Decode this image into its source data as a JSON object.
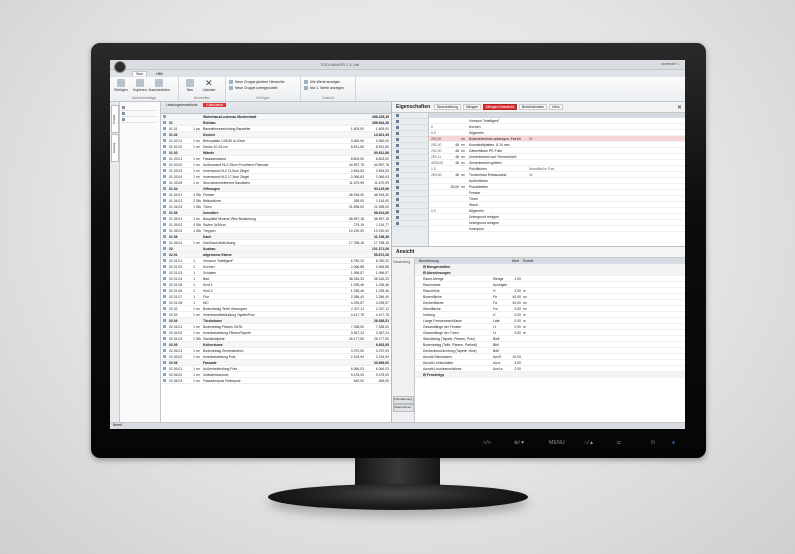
{
  "window": {
    "title": "TOOLMAKER 2.4 Lite",
    "user": "Anwender 1"
  },
  "ribbon": {
    "tabs": [
      "Start",
      "Hilfe"
    ],
    "groups": [
      {
        "label": "Zwischenablage",
        "buttons": [
          "Einfügen",
          "Kopieren",
          "Ausschneiden"
        ]
      },
      {
        "label": "Bearbeiten",
        "buttons": [
          "Neu",
          "Löschen"
        ]
      },
      {
        "label": "Einfügen",
        "small": [
          "Neue Gruppe gleicher Hierarchie",
          "Neue Gruppe untergeordnet"
        ]
      },
      {
        "label": "Ansicht",
        "small": [
          "Alle Werte anzeigen",
          "Nur 1. Werte anzeigen"
        ]
      }
    ]
  },
  "left_tabs": [
    "Projekt",
    "Katalog"
  ],
  "center": {
    "tabs": [
      "Leistungsverzeichnis",
      "Kalkulation"
    ],
    "rows": [
      {
        "pos": "",
        "qty": "",
        "u": "",
        "desc": "Wohnhaus/Lustenau Musterstadt",
        "p": "",
        "t": "286.225,35",
        "bold": true
      },
      {
        "pos": "01",
        "qty": "",
        "u": "",
        "desc": "Rohbau",
        "p": "",
        "t": "258.544,28",
        "bold": true
      },
      {
        "pos": "01.01",
        "qty": "1",
        "u": "pa",
        "desc": "Baustelleneinrichtung Baustelle",
        "p": "1.605,00",
        "t": "1.605,00",
        "bold": false
      },
      {
        "pos": "01.02",
        "qty": "",
        "u": "",
        "desc": "Decken",
        "p": "",
        "t": "14.301,49",
        "bold": true
      },
      {
        "pos": "01.02.01",
        "qty": "1",
        "u": "m²",
        "desc": "Betonplatte C25/30 d=20cm",
        "p": "3.360,00",
        "t": "3.360,00",
        "bold": false
      },
      {
        "pos": "01.02.02",
        "qty": "1",
        "u": "m²",
        "desc": "Decke 20-25 cm",
        "p": "8.531,60",
        "t": "8.531,60",
        "bold": false
      },
      {
        "pos": "01.03",
        "qty": "",
        "u": "",
        "desc": "Wände",
        "p": "",
        "t": "69.811,86",
        "bold": true
      },
      {
        "pos": "01.03.01",
        "qty": "1",
        "u": "m²",
        "desc": "Fassadenwand",
        "p": "8.803,00",
        "t": "8.803,00",
        "bold": false
      },
      {
        "pos": "01.03.02",
        "qty": "1",
        "u": "m²",
        "desc": "Außenwand HLZ 25cm Porotherm Plansatz",
        "p": "44.957,78",
        "t": "44.957,78",
        "bold": false
      },
      {
        "pos": "01.03.03",
        "qty": "1",
        "u": "m²",
        "desc": "Innenwand HLZ 11,5cm Ziegel",
        "p": "2.694,63",
        "t": "2.694,63",
        "bold": false
      },
      {
        "pos": "01.03.04",
        "qty": "1",
        "u": "m²",
        "desc": "Innenwand HLZ 17,5cm Ziegel",
        "p": "2.066,63",
        "t": "2.066,63",
        "bold": false
      },
      {
        "pos": "01.03.05",
        "qty": "1",
        "u": "m",
        "desc": "Sturzdeckenelement Sandstein",
        "p": "11.679,99",
        "t": "11.679,99",
        "bold": false
      },
      {
        "pos": "01.04",
        "qty": "",
        "u": "",
        "desc": "Öffnungen",
        "p": "",
        "t": "93.119,06",
        "bold": true
      },
      {
        "pos": "01.04.01",
        "qty": "3",
        "u": "Stk",
        "desc": "Fenster",
        "p": "46.918,40",
        "t": "46.918,40",
        "bold": false
      },
      {
        "pos": "01.04.02",
        "qty": "2",
        "u": "Stk",
        "desc": "Balkontüren",
        "p": "285,00",
        "t": "1.118,00",
        "bold": false
      },
      {
        "pos": "01.04.03",
        "qty": "1",
        "u": "Stk",
        "desc": "Türen",
        "p": "21.598,00",
        "t": "21.598,00",
        "bold": false
      },
      {
        "pos": "01.05",
        "qty": "",
        "u": "",
        "desc": "Innentüre",
        "p": "",
        "t": "58.614,80",
        "bold": true
      },
      {
        "pos": "01.05.01",
        "qty": "1",
        "u": "m²",
        "desc": "Bauplatte Mineral Vlies Bedachung",
        "p": "58.957,18",
        "t": "58.957,18",
        "bold": false
      },
      {
        "pos": "01.05.02",
        "qty": "4",
        "u": "Stk",
        "desc": "Stufen 3x30cm",
        "p": "279,19",
        "t": "1.116,77",
        "bold": false
      },
      {
        "pos": "01.05.03",
        "qty": "1",
        "u": "Stk",
        "desc": "Treppen",
        "p": "10.190,00",
        "t": "10.190,00",
        "bold": false
      },
      {
        "pos": "01.06",
        "qty": "",
        "u": "",
        "desc": "Dach",
        "p": "",
        "t": "31.198,36",
        "bold": true
      },
      {
        "pos": "01.06.01",
        "qty": "1",
        "u": "m²",
        "desc": "Dachhaut Abdichtung",
        "p": "17.788,16",
        "t": "17.788,16",
        "bold": false
      },
      {
        "pos": "02",
        "qty": "",
        "u": "",
        "desc": "Ausbau",
        "p": "",
        "t": "101.371,06",
        "bold": true
      },
      {
        "pos": "02.01",
        "qty": "",
        "u": "",
        "desc": "allgemeine Ebene",
        "p": "",
        "t": "55.672,26",
        "bold": true
      },
      {
        "pos": "02.01.01",
        "qty": "1",
        "u": "",
        "desc": "Vorraum \"Intelligent\"",
        "p": "6.780,20",
        "t": "6.780,20",
        "bold": false
      },
      {
        "pos": "02.01.02",
        "qty": "1",
        "u": "",
        "desc": "Kochen",
        "p": "2.066,88",
        "t": "2.066,88",
        "bold": false
      },
      {
        "pos": "02.01.03",
        "qty": "1",
        "u": "",
        "desc": "Schlafen",
        "p": "1.996,57",
        "t": "1.996,57",
        "bold": false
      },
      {
        "pos": "02.01.04",
        "qty": "1",
        "u": "",
        "desc": "Bad",
        "p": "38.316,20",
        "t": "38.316,20",
        "bold": false
      },
      {
        "pos": "02.01.05",
        "qty": "1",
        "u": "",
        "desc": "Kind 1",
        "p": "1.035,46",
        "t": "1.035,46",
        "bold": false
      },
      {
        "pos": "02.01.06",
        "qty": "1",
        "u": "",
        "desc": "Kind 2",
        "p": "1.035,46",
        "t": "1.035,46",
        "bold": false
      },
      {
        "pos": "02.01.07",
        "qty": "1",
        "u": "",
        "desc": "Flur",
        "p": "2.286,40",
        "t": "2.286,40",
        "bold": false
      },
      {
        "pos": "02.01.08",
        "qty": "1",
        "u": "",
        "desc": "WC",
        "p": "4.295,57",
        "t": "4.295,57",
        "bold": false
      },
      {
        "pos": "02.02",
        "qty": "1",
        "u": "m²",
        "desc": "Bodenbelag Textil Velourgarn",
        "p": "2.327,11",
        "t": "2.327,11",
        "bold": false
      },
      {
        "pos": "02.03",
        "qty": "1",
        "u": "m²",
        "desc": "Innenwandbekleidung Tapete/Putz",
        "p": "4.417,78",
        "t": "4.417,78",
        "bold": false
      },
      {
        "pos": "02.04",
        "qty": "",
        "u": "",
        "desc": "Türzünkane",
        "p": "",
        "t": "26.938,51",
        "bold": true
      },
      {
        "pos": "02.04.01",
        "qty": "1",
        "u": "m²",
        "desc": "Bodenbelag Fliesen 30/30",
        "p": "7.338,00",
        "t": "7.338,00",
        "bold": false
      },
      {
        "pos": "02.04.02",
        "qty": "1",
        "u": "m²",
        "desc": "Innenbekleidung Fliesen/Tapete",
        "p": "3.367,24",
        "t": "3.367,24",
        "bold": false
      },
      {
        "pos": "02.04.03",
        "qty": "1",
        "u": "Stk",
        "desc": "Sanitärobjekte",
        "p": "26.177,50",
        "t": "26.177,50",
        "bold": false
      },
      {
        "pos": "02.05",
        "qty": "",
        "u": "",
        "desc": "Kellerräume",
        "p": "",
        "t": "6.633,95",
        "bold": true
      },
      {
        "pos": "02.05.01",
        "qty": "1",
        "u": "m²",
        "desc": "Bodenbelag Zementestrich",
        "p": "3.370,00",
        "t": "3.370,00",
        "bold": false
      },
      {
        "pos": "02.05.02",
        "qty": "1",
        "u": "m²",
        "desc": "Innenbekleidung Putz",
        "p": "2.194,94",
        "t": "2.194,94",
        "bold": false
      },
      {
        "pos": "02.06",
        "qty": "",
        "u": "",
        "desc": "Fassade",
        "p": "",
        "t": "33.696,00",
        "bold": true
      },
      {
        "pos": "02.06.01",
        "qty": "1",
        "u": "m²",
        "desc": "Außenbekleidung Putz",
        "p": "6.066,03",
        "t": "6.066,03",
        "bold": false
      },
      {
        "pos": "02.06.02",
        "qty": "1",
        "u": "m²",
        "desc": "Vollwärmeschutz",
        "p": "9.478,00",
        "t": "9.478,00",
        "bold": false
      },
      {
        "pos": "02.06.03",
        "qty": "1",
        "u": "m²",
        "desc": "Fassadenputz Reibeputz",
        "p": "469,00",
        "t": "469,00",
        "bold": false
      }
    ]
  },
  "properties": {
    "title": "Eigenschaften",
    "tabs": [
      "Beschreibung",
      "Mengen",
      "Mengen Übersicht",
      "Betriebskosten",
      "Infos"
    ],
    "active_tab": "Mengen Übersicht",
    "rows": [
      {
        "a": "",
        "b": "",
        "c": "",
        "d": "Vorraum \"Intelligent\"",
        "e": "",
        "sel": false
      },
      {
        "a": "0",
        "b": "",
        "c": "",
        "d": "Kochen",
        "e": "",
        "sel": false
      },
      {
        "a": "0.0",
        "b": "",
        "c": "",
        "d": "Allgemein",
        "e": "",
        "sel": false
      },
      {
        "a": "252,00",
        "b": "",
        "c": "m²",
        "d": "Bodenelemente anbringen, Estrich",
        "e": "Nr.",
        "sel": true
      },
      {
        "a": "252,00",
        "b": "48",
        "c": "m²",
        "d": "Kunststoffplatten, 8-10 mm",
        "e": "",
        "sel": false
      },
      {
        "a": "252,00",
        "b": "48",
        "c": "m²",
        "d": "Dämmfläche PE-Folie",
        "e": "",
        "sel": false
      },
      {
        "a": "252,11",
        "b": "48",
        "c": "m²",
        "d": "Zementestrich auf Trennschicht",
        "e": "",
        "sel": false
      },
      {
        "a": "4039,00",
        "b": "48",
        "c": "m²",
        "d": "Zementestrich glätten",
        "e": "",
        "sel": false
      },
      {
        "a": "1.0",
        "b": "",
        "c": "",
        "d": "Putzflächen",
        "e": "Wandfläche Putz",
        "sel": false
      },
      {
        "a": "263,00",
        "b": "48",
        "c": "m²",
        "d": "Trockenbau Einbauwand",
        "e": "Nr.",
        "sel": false
      },
      {
        "a": "",
        "b": "",
        "c": "",
        "d": "Außenfläche",
        "e": "",
        "sel": false
      },
      {
        "a": "",
        "b": "25,60",
        "c": "m²",
        "d": "Putzarbeiten",
        "e": "",
        "sel": false
      },
      {
        "a": "",
        "b": "",
        "c": "",
        "d": "Fenster",
        "e": "",
        "sel": false
      },
      {
        "a": "",
        "b": "",
        "c": "",
        "d": "Türen",
        "e": "",
        "sel": false
      },
      {
        "a": "",
        "b": "",
        "c": "",
        "d": "Wand",
        "e": "",
        "sel": false
      },
      {
        "a": "0.0",
        "b": "",
        "c": "",
        "d": "Allgemein",
        "e": "",
        "sel": false
      },
      {
        "a": "",
        "b": "",
        "c": "",
        "d": "Untergrund reinigen",
        "e": "",
        "sel": false
      },
      {
        "a": "",
        "b": "",
        "c": "",
        "d": "Untergrund reinigen",
        "e": "",
        "sel": false
      },
      {
        "a": "",
        "b": "",
        "c": "",
        "d": "Innenputz",
        "e": "",
        "sel": false
      }
    ]
  },
  "ansicht": {
    "title": "Ansicht",
    "left_label": "Darstellung",
    "buttons": [
      "Formatierung",
      "Übernehmen"
    ],
    "header": "Bezeichnung",
    "col_labels": [
      "Wert",
      "Einheit"
    ],
    "groups": [
      {
        "name": "Mengenstellen",
        "items": []
      },
      {
        "name": "Abrechnungen",
        "items": [
          {
            "n": "Raum-Menge",
            "v": "Menge",
            "w": "1,00",
            "u": ""
          },
          {
            "n": "Raumname",
            "v": "Anzeigen",
            "w": "",
            "u": ""
          },
          {
            "n": "Raumhöhe",
            "v": "H",
            "w": "2,50",
            "u": "m"
          },
          {
            "n": "Bodenfläche",
            "v": "Fb",
            "w": "40,00",
            "u": "m²"
          },
          {
            "n": "Deckenfläche",
            "v": "Fd",
            "w": "40,00",
            "u": "m²"
          },
          {
            "n": "Wandfläche",
            "v": "Fw",
            "w": "0,00",
            "u": "m²"
          },
          {
            "n": "Umfang",
            "v": "U",
            "w": "0,00",
            "u": "m"
          },
          {
            "n": "Länge Fensteranschlüsse",
            "v": "Lafe",
            "w": "0,00",
            "u": "m"
          },
          {
            "n": "Gesamtlänge der Fenster",
            "v": "Lf",
            "w": "0,00",
            "u": "m"
          },
          {
            "n": "Gesamtlänge der Türen",
            "v": "Lt",
            "w": "0,00",
            "u": "m"
          },
          {
            "n": "Wandbelag (Tapete, Fliesen, Putz)",
            "v": "Bwfl",
            "w": "",
            "u": ""
          },
          {
            "n": "Bodenbelag (Teilb, Fliesen, Parkett)",
            "v": "Bbfl",
            "w": "",
            "u": ""
          },
          {
            "n": "Deckenbeschichtung (Tapete, Holz)",
            "v": "Bdfl",
            "w": "",
            "u": ""
          },
          {
            "n": "Anzahl Steckdosen",
            "v": "AnzS",
            "w": "10,00",
            "u": ""
          },
          {
            "n": "Anzahl Lichtschalter",
            "v": "AnzL",
            "w": "3,00",
            "u": ""
          },
          {
            "n": "Anzahl Leuchtanschlüsse",
            "v": "AnzLe",
            "w": "2,00",
            "u": ""
          }
        ]
      },
      {
        "name": "Fenstertyp",
        "items": []
      }
    ]
  },
  "status": "Bereit",
  "monitor_controls": [
    "□/□",
    "⊕/▼",
    "MENU",
    "○/▲",
    "⊏",
    "⏻"
  ],
  "colors": {
    "accent": "#d9343a",
    "selection": "#f7d6d8",
    "header": "#dde2e8"
  }
}
